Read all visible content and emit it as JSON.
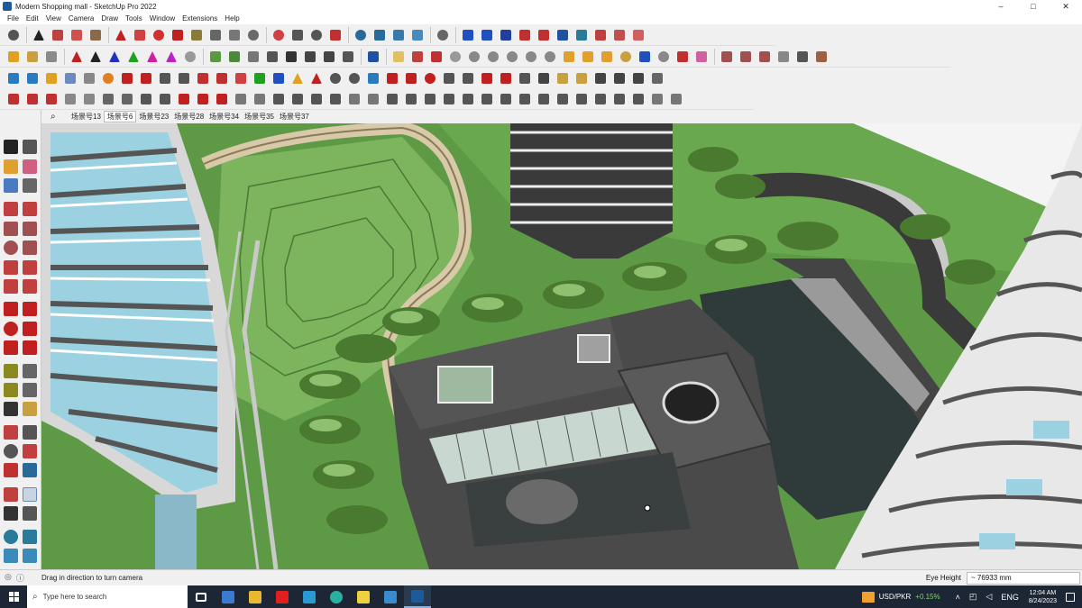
{
  "window": {
    "title": "Modern Shopping mall - SketchUp Pro 2022",
    "controls": [
      "–",
      "□",
      "✕"
    ]
  },
  "menu": [
    "File",
    "Edit",
    "View",
    "Camera",
    "Draw",
    "Tools",
    "Window",
    "Extensions",
    "Help"
  ],
  "scenes": {
    "tabs": [
      "场景号13",
      "场景号6",
      "场景号23",
      "场景号28",
      "场景号34",
      "场景号35",
      "场景号37"
    ],
    "active": "场景号6"
  },
  "status": {
    "message": "Drag in direction to turn camera",
    "vcb_label": "Eye Height",
    "vcb_value": "~ 76933 mm"
  },
  "taskbar": {
    "search_placeholder": "Type here to search",
    "ticker_label": "USD/PKR",
    "ticker_change": "+0.15%",
    "language": "ENG",
    "time": "12:04 AM",
    "date": "8/24/2023"
  },
  "colors": {
    "lawn": "#5e9a46",
    "lawn_light": "#7cb55e",
    "roof_dark": "#4a4a4a",
    "path_tan": "#d8c9a8",
    "tower_glass": "#9bd1e0",
    "taskbar": "#1c2634"
  }
}
